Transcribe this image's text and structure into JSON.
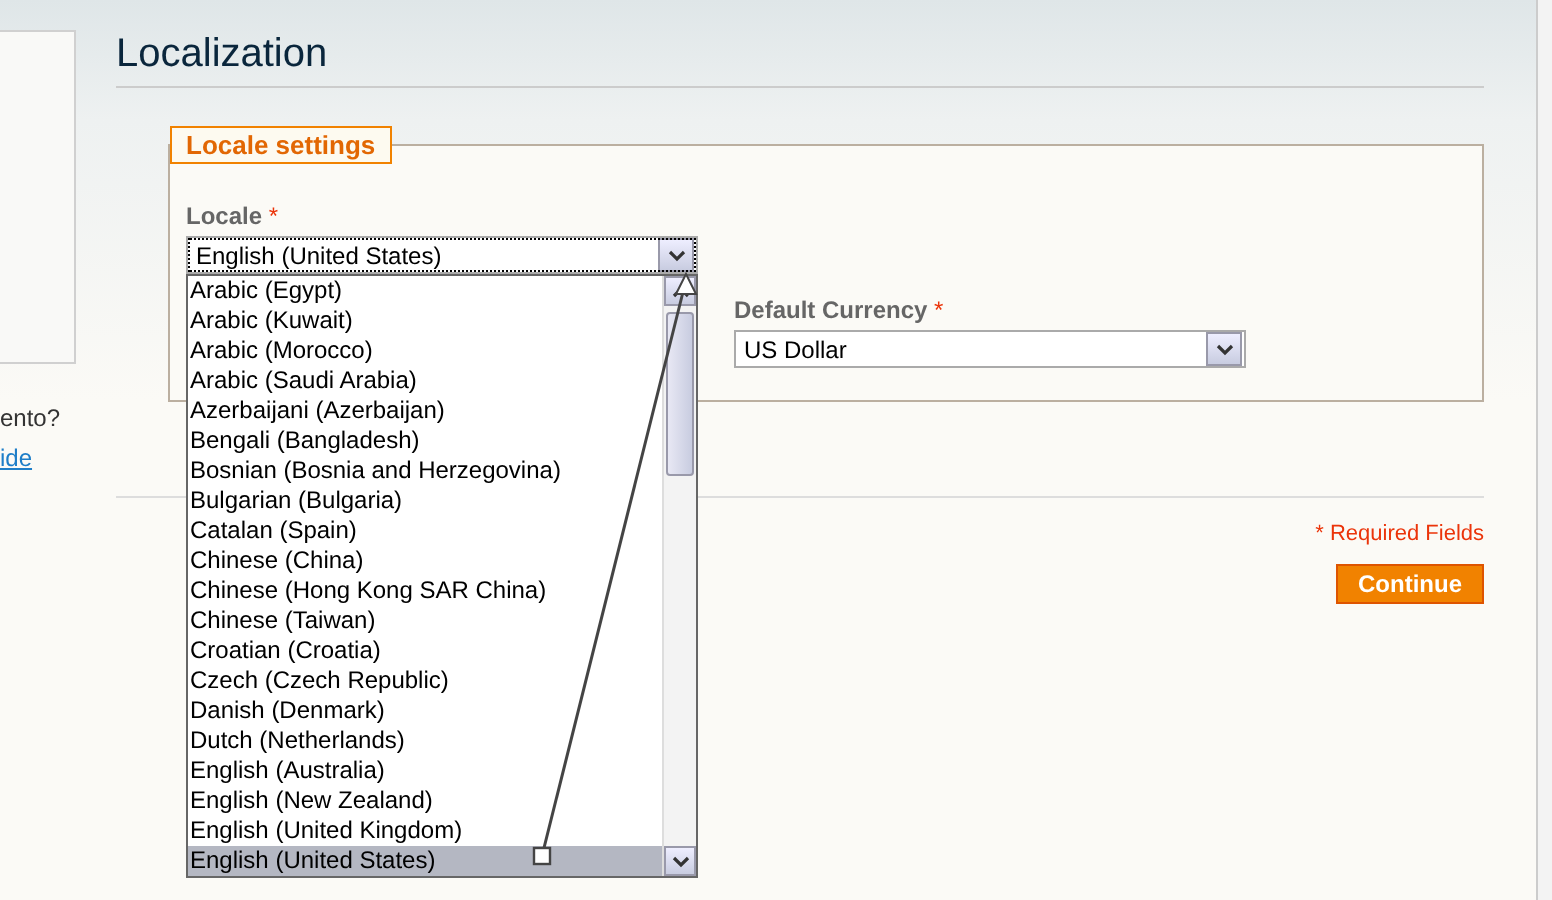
{
  "sidebar": {
    "question": "ento?",
    "link": "ide"
  },
  "page": {
    "title": "Localization"
  },
  "fieldset": {
    "legend": "Locale settings"
  },
  "locale": {
    "label": "Locale",
    "required": "*",
    "value": "English (United States)",
    "expanded": true,
    "options": [
      {
        "label": "Arabic (Egypt)",
        "selected": false
      },
      {
        "label": "Arabic (Kuwait)",
        "selected": false
      },
      {
        "label": "Arabic (Morocco)",
        "selected": false
      },
      {
        "label": "Arabic (Saudi Arabia)",
        "selected": false
      },
      {
        "label": "Azerbaijani (Azerbaijan)",
        "selected": false
      },
      {
        "label": "Bengali (Bangladesh)",
        "selected": false
      },
      {
        "label": "Bosnian (Bosnia and Herzegovina)",
        "selected": false
      },
      {
        "label": "Bulgarian (Bulgaria)",
        "selected": false
      },
      {
        "label": "Catalan (Spain)",
        "selected": false
      },
      {
        "label": "Chinese (China)",
        "selected": false
      },
      {
        "label": "Chinese (Hong Kong SAR China)",
        "selected": false
      },
      {
        "label": "Chinese (Taiwan)",
        "selected": false
      },
      {
        "label": "Croatian (Croatia)",
        "selected": false
      },
      {
        "label": "Czech (Czech Republic)",
        "selected": false
      },
      {
        "label": "Danish (Denmark)",
        "selected": false
      },
      {
        "label": "Dutch (Netherlands)",
        "selected": false
      },
      {
        "label": "English (Australia)",
        "selected": false
      },
      {
        "label": "English (New Zealand)",
        "selected": false
      },
      {
        "label": "English (United Kingdom)",
        "selected": false
      },
      {
        "label": "English (United States)",
        "selected": true
      }
    ]
  },
  "currency": {
    "label": "Default Currency",
    "required": "*",
    "value": "US Dollar"
  },
  "footer": {
    "required_note": "* Required Fields",
    "button": "Continue"
  }
}
